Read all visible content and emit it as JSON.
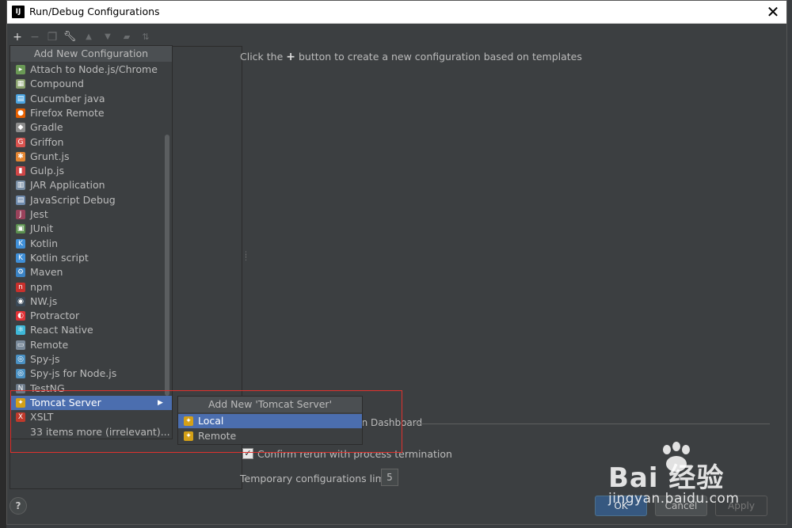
{
  "dialog": {
    "title": "Run/Debug Configurations",
    "title_icon_text": "IJ"
  },
  "toolbar": {
    "icons": [
      "plus-icon",
      "minus-icon",
      "copy-icon",
      "wrench-icon",
      "arrow-up-icon",
      "arrow-down-icon",
      "folder-icon",
      "sort-icon"
    ]
  },
  "popup": {
    "header": "Add New Configuration",
    "items": [
      {
        "label": "Attach to Node.js/Chrome",
        "icon": "attach-nodejs-icon",
        "color": "#6a9955",
        "glyph": "▸"
      },
      {
        "label": "Compound",
        "icon": "compound-icon",
        "color": "#8aa36e",
        "glyph": "▦"
      },
      {
        "label": "Cucumber java",
        "icon": "cucumber-icon",
        "color": "#4aa3df",
        "glyph": "▤"
      },
      {
        "label": "Firefox Remote",
        "icon": "firefox-icon",
        "color": "#e66000",
        "glyph": "●"
      },
      {
        "label": "Gradle",
        "icon": "gradle-icon",
        "color": "#8c8c8c",
        "glyph": "◆"
      },
      {
        "label": "Griffon",
        "icon": "griffon-icon",
        "color": "#d9534f",
        "glyph": "G"
      },
      {
        "label": "Grunt.js",
        "icon": "grunt-icon",
        "color": "#e48632",
        "glyph": "✱"
      },
      {
        "label": "Gulp.js",
        "icon": "gulp-icon",
        "color": "#cf4647",
        "glyph": "▮"
      },
      {
        "label": "JAR Application",
        "icon": "jar-icon",
        "color": "#7a8fa6",
        "glyph": "▥"
      },
      {
        "label": "JavaScript Debug",
        "icon": "js-debug-icon",
        "color": "#6f8bad",
        "glyph": "▤"
      },
      {
        "label": "Jest",
        "icon": "jest-icon",
        "color": "#99425b",
        "glyph": "J"
      },
      {
        "label": "JUnit",
        "icon": "junit-icon",
        "color": "#5a8f4e",
        "glyph": "▣"
      },
      {
        "label": "Kotlin",
        "icon": "kotlin-icon",
        "color": "#3f8fd8",
        "glyph": "K"
      },
      {
        "label": "Kotlin script",
        "icon": "kotlin-script-icon",
        "color": "#3f8fd8",
        "glyph": "K"
      },
      {
        "label": "Maven",
        "icon": "maven-icon",
        "color": "#3b83c4",
        "glyph": "⚙"
      },
      {
        "label": "npm",
        "icon": "npm-icon",
        "color": "#c9302c",
        "glyph": "n"
      },
      {
        "label": "NW.js",
        "icon": "nwjs-icon",
        "color": "#3b4a58",
        "glyph": "◉"
      },
      {
        "label": "Protractor",
        "icon": "protractor-icon",
        "color": "#e23237",
        "glyph": "◐"
      },
      {
        "label": "React Native",
        "icon": "react-native-icon",
        "color": "#3fb8d8",
        "glyph": "⚛"
      },
      {
        "label": "Remote",
        "icon": "remote-icon",
        "color": "#7a8a9a",
        "glyph": "▭"
      },
      {
        "label": "Spy-js",
        "icon": "spy-js-icon",
        "color": "#4a90c2",
        "glyph": "◎"
      },
      {
        "label": "Spy-js for Node.js",
        "icon": "spy-js-node-icon",
        "color": "#4a90c2",
        "glyph": "◎"
      },
      {
        "label": "TestNG",
        "icon": "testng-icon",
        "color": "#6c7a89",
        "glyph": "N"
      },
      {
        "label": "Tomcat Server",
        "icon": "tomcat-icon",
        "color": "#d4a017",
        "glyph": "✦",
        "selected": true,
        "has_submenu": true
      },
      {
        "label": "XSLT",
        "icon": "xslt-icon",
        "color": "#c0392b",
        "glyph": "X"
      },
      {
        "label": "33 items more (irrelevant)...",
        "icon": "",
        "color": "",
        "glyph": ""
      }
    ]
  },
  "submenu": {
    "header": "Add New 'Tomcat Server' Configuration",
    "items": [
      {
        "label": "Local",
        "icon": "tomcat-local-icon",
        "selected": true
      },
      {
        "label": "Remote",
        "icon": "tomcat-remote-icon",
        "selected": false
      }
    ]
  },
  "main": {
    "hint_before": "Click the",
    "hint_plus": "+",
    "hint_after": "button to create a new configuration based on templates",
    "dashboard_label": "un Dashboard",
    "confirm_label": "Confirm rerun with process termination",
    "confirm_checked": true,
    "temp_limit_label": "Temporary configurations limit:",
    "temp_limit_value": "5"
  },
  "footer": {
    "help": "?",
    "ok": "OK",
    "cancel": "Cancel",
    "apply": "Apply"
  },
  "watermark": {
    "brand": "Bai  经验",
    "url": "jingyan.baidu.com"
  },
  "colors": {
    "selection": "#4b6eaf",
    "annotation": "#e0322e",
    "dialog_bg": "#3c3f41"
  }
}
